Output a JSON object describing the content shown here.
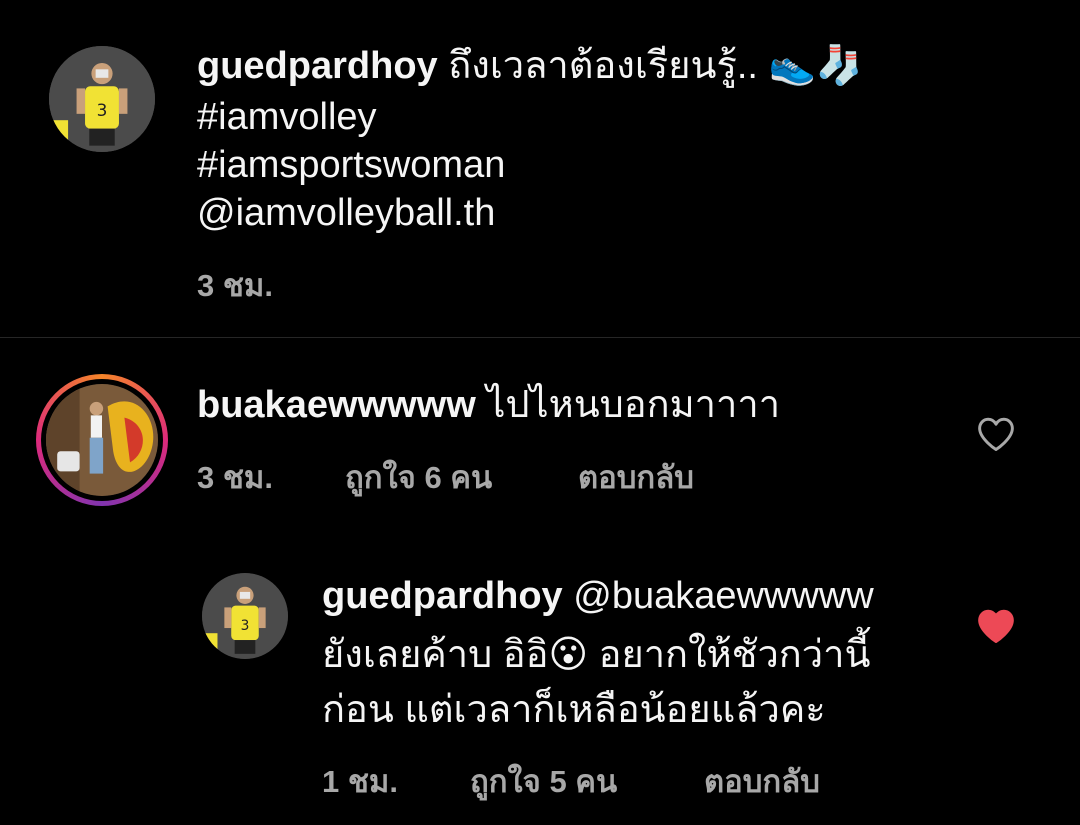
{
  "post": {
    "username": "guedpardhoy",
    "text_line1": "ถึงเวลาต้องเรียนรู้..",
    "emoji_shoe": "👟",
    "emoji_socks": "🧦",
    "hashtag1": "#iamvolley",
    "hashtag2": "#iamsportswoman",
    "mention": "@iamvolleyball.th",
    "time": "3 ชม."
  },
  "comments": [
    {
      "username": "buakaewwwww",
      "text": "ไปไหนบอกมาาาา",
      "time": "3 ชม.",
      "likes": "ถูกใจ 6 คน",
      "reply_label": "ตอบกลับ",
      "liked": false
    },
    {
      "username": "guedpardhoy",
      "mention": "@buakaewwwww",
      "text_line1": "ยังเลยค้าบ อิอิ",
      "emoji": "😮",
      "text_line1_after": " อยากให้ชัวกว่านี้",
      "text_line2": "ก่อน แต่เวลาก็เหลือน้อยแล้วคะ",
      "time": "1 ชม.",
      "likes": "ถูกใจ 5 คน",
      "reply_label": "ตอบกลับ",
      "liked": true
    }
  ],
  "colors": {
    "background": "#000000",
    "text": "#f5f5f5",
    "meta": "#a8a8a8",
    "liked_heart": "#ed4956",
    "divider": "#262626"
  }
}
